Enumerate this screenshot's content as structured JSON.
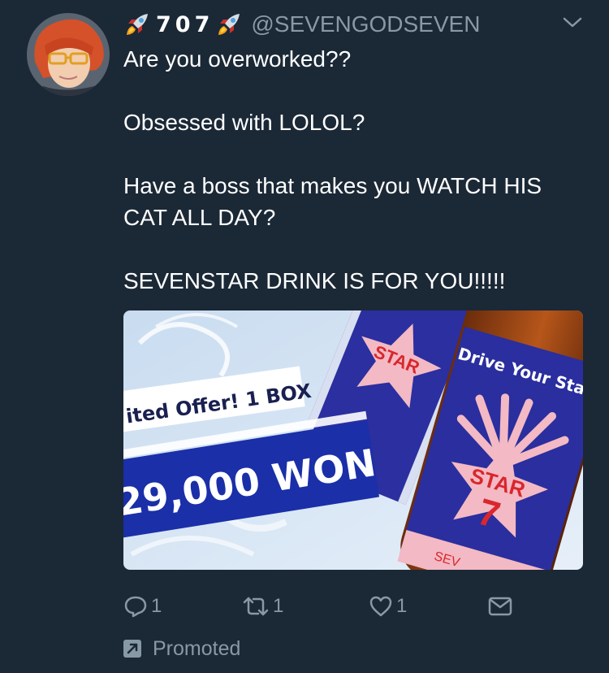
{
  "tweet": {
    "display_name": "707",
    "handle": "@SEVENGODSEVEN",
    "paragraphs": [
      "Are you overworked??",
      "Obsessed with LOLOL?",
      "Have a boss that makes you WATCH HIS CAT ALL DAY?",
      "SEVENSTAR DRINK IS FOR YOU!!!!!"
    ]
  },
  "media": {
    "offer_text": "ited Offer! 1 BOX",
    "price_text": "29,000 WON",
    "bottle_slogan": "Drive Your Star!",
    "star_label": "STAR",
    "star_number": "7",
    "bottle_label_partial": "SEV",
    "colors": {
      "bottle_blue": "#2a2e9e",
      "price_banner": "#1a2fa8",
      "star_pink": "#f3b9c4",
      "seven_red": "#d8272d"
    }
  },
  "actions": {
    "reply_count": "1",
    "retweet_count": "1",
    "like_count": "1",
    "icons": [
      "reply-icon",
      "retweet-icon",
      "heart-icon",
      "message-icon"
    ]
  },
  "promoted": {
    "label": "Promoted",
    "icon": "promoted-arrow-icon"
  },
  "colors": {
    "background": "#1b2836",
    "secondary_text": "#8899a6",
    "primary_text": "#ffffff"
  }
}
